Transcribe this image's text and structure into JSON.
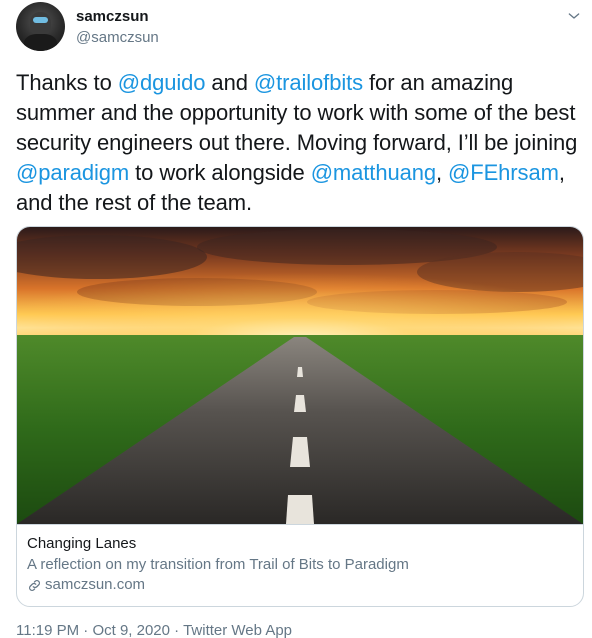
{
  "author": {
    "display_name": "samczsun",
    "handle": "@samczsun",
    "avatar_icon": "user-avatar"
  },
  "tweet": {
    "parts": [
      {
        "type": "text",
        "value": "Thanks to "
      },
      {
        "type": "mention",
        "value": "@dguido"
      },
      {
        "type": "text",
        "value": " and "
      },
      {
        "type": "mention",
        "value": "@trailofbits"
      },
      {
        "type": "text",
        "value": " for an amazing summer and the opportunity to work with some of the best security engineers out there. Moving forward, I’ll be joining "
      },
      {
        "type": "mention",
        "value": "@paradigm"
      },
      {
        "type": "text",
        "value": " to work alongside "
      },
      {
        "type": "mention",
        "value": "@matthuang"
      },
      {
        "type": "text",
        "value": ", "
      },
      {
        "type": "mention",
        "value": "@FEhrsam"
      },
      {
        "type": "text",
        "value": ", and the rest of the team."
      }
    ]
  },
  "card": {
    "title": "Changing Lanes",
    "description": "A reflection on my transition from Trail of Bits to Paradigm",
    "domain": "samczsun.com",
    "link_icon": "link-icon"
  },
  "meta": {
    "time": "11:19 PM",
    "separator": "·",
    "date": "Oct 9, 2020",
    "source": "Twitter Web App"
  },
  "colors": {
    "mention": "#1b95e0",
    "secondary_text": "#657786",
    "border": "#ccd6dd"
  }
}
